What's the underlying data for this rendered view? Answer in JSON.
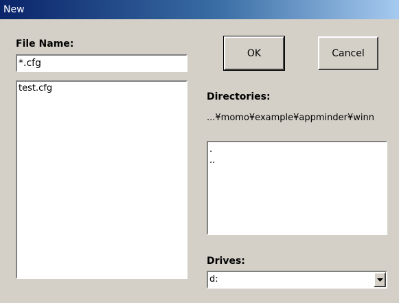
{
  "window": {
    "title": "New"
  },
  "file_name": {
    "label": "File Name:",
    "value": "*.cfg"
  },
  "files": [
    "test.cfg"
  ],
  "buttons": {
    "ok": "OK",
    "cancel": "Cancel"
  },
  "directories": {
    "label": "Directories:",
    "path": "...¥momo¥example¥appminder¥winn",
    "items": [
      ".",
      ".."
    ]
  },
  "drives": {
    "label": "Drives:",
    "selected": "d:"
  },
  "icons": {
    "dropdown": "chevron-down-icon"
  }
}
